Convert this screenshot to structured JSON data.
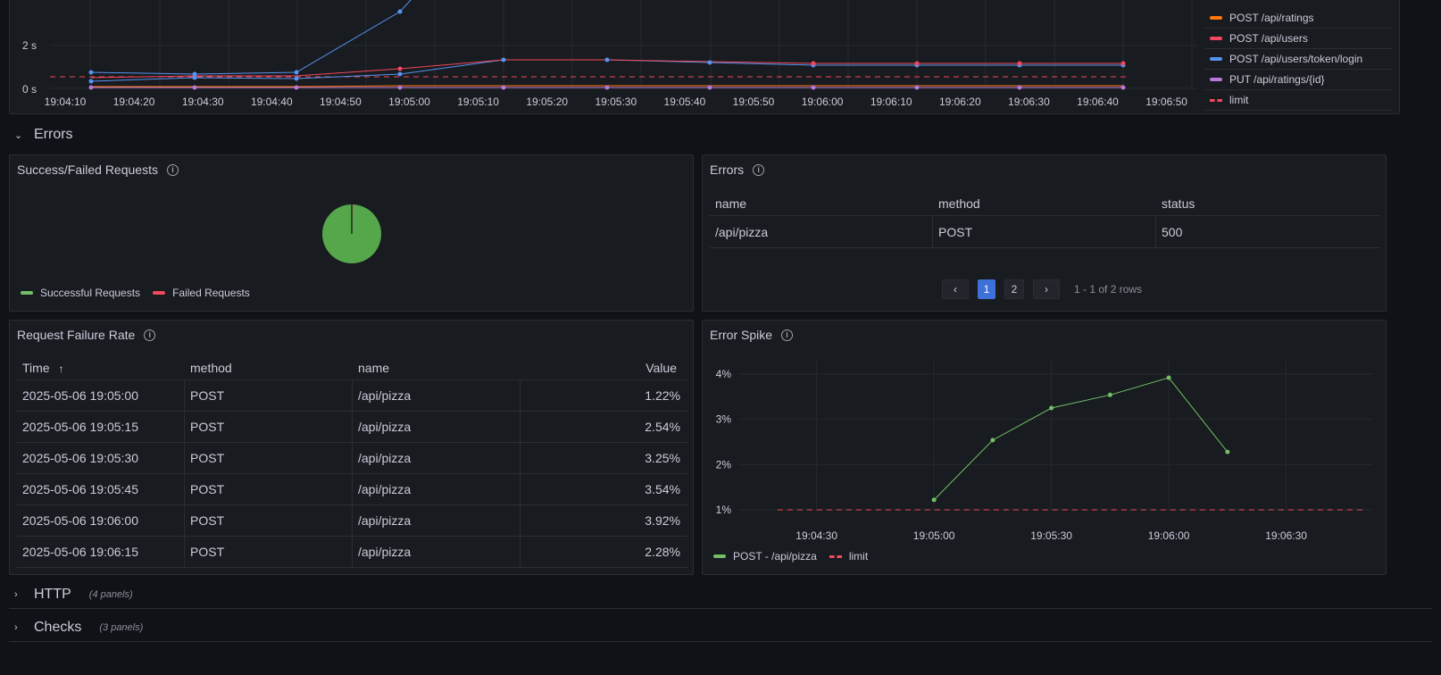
{
  "top_chart": {
    "y_ticks": [
      "2 s",
      "0 s"
    ],
    "x_ticks": [
      "19:04:10",
      "19:04:20",
      "19:04:30",
      "19:04:40",
      "19:04:50",
      "19:05:00",
      "19:05:10",
      "19:05:20",
      "19:05:30",
      "19:05:40",
      "19:05:50",
      "19:06:00",
      "19:06:10",
      "19:06:20",
      "19:06:30",
      "19:06:40",
      "19:06:50"
    ],
    "legend": [
      {
        "label": "POST /api/ratings",
        "color": "#ff780a"
      },
      {
        "label": "POST /api/users",
        "color": "#f2495c"
      },
      {
        "label": "POST /api/users/token/login",
        "color": "#5794f2"
      },
      {
        "label": "PUT /api/ratings/{id}",
        "color": "#b877d9"
      },
      {
        "label": "limit",
        "color": "#f2495c",
        "dashed": true
      }
    ]
  },
  "rows": {
    "errors": {
      "title": "Errors"
    },
    "http": {
      "title": "HTTP",
      "sub": "(4 panels)"
    },
    "checks": {
      "title": "Checks",
      "sub": "(3 panels)"
    }
  },
  "success_panel": {
    "title": "Success/Failed Requests",
    "legend": [
      {
        "label": "Successful Requests",
        "color": "#73bf69"
      },
      {
        "label": "Failed Requests",
        "color": "#f2495c"
      }
    ],
    "values": {
      "successful_fraction": 0.995,
      "failed_fraction": 0.005
    }
  },
  "errors_panel": {
    "title": "Errors",
    "columns": [
      "name",
      "method",
      "status"
    ],
    "rows": [
      [
        "/api/pizza",
        "POST",
        "500"
      ]
    ],
    "pager": {
      "pages": [
        "1",
        "2"
      ],
      "active": "1",
      "summary": "1 - 1 of 2 rows",
      "prev": "‹",
      "next": "›"
    }
  },
  "failure_rate_panel": {
    "title": "Request Failure Rate",
    "columns": [
      "Time",
      "method",
      "name",
      "Value"
    ],
    "sort_indicator": "↑",
    "rows": [
      [
        "2025-05-06 19:05:00",
        "POST",
        "/api/pizza",
        "1.22%"
      ],
      [
        "2025-05-06 19:05:15",
        "POST",
        "/api/pizza",
        "2.54%"
      ],
      [
        "2025-05-06 19:05:30",
        "POST",
        "/api/pizza",
        "3.25%"
      ],
      [
        "2025-05-06 19:05:45",
        "POST",
        "/api/pizza",
        "3.54%"
      ],
      [
        "2025-05-06 19:06:00",
        "POST",
        "/api/pizza",
        "3.92%"
      ],
      [
        "2025-05-06 19:06:15",
        "POST",
        "/api/pizza",
        "2.28%"
      ]
    ]
  },
  "chart_data": {
    "type": "line",
    "title": "Error Spike",
    "x_ticks": [
      "19:04:30",
      "19:05:00",
      "19:05:30",
      "19:06:00",
      "19:06:30"
    ],
    "y_ticks": [
      "4%",
      "3%",
      "2%",
      "1%"
    ],
    "ylim": [
      1,
      4
    ],
    "xlim": [
      "19:04:10",
      "19:06:52"
    ],
    "series": [
      {
        "name": "POST - /api/pizza",
        "color": "#73bf69",
        "x": [
          "19:05:00",
          "19:05:15",
          "19:05:30",
          "19:05:45",
          "19:06:00",
          "19:06:15"
        ],
        "values": [
          1.22,
          2.54,
          3.25,
          3.54,
          3.92,
          2.28
        ]
      },
      {
        "name": "limit",
        "color": "#f2495c",
        "dashed": true,
        "x": [
          "19:04:20",
          "19:06:50"
        ],
        "values": [
          1,
          1
        ]
      }
    ],
    "legend": [
      {
        "label": "POST - /api/pizza",
        "color": "#73bf69"
      },
      {
        "label": "limit",
        "color": "#f2495c",
        "dashed": true
      }
    ]
  }
}
